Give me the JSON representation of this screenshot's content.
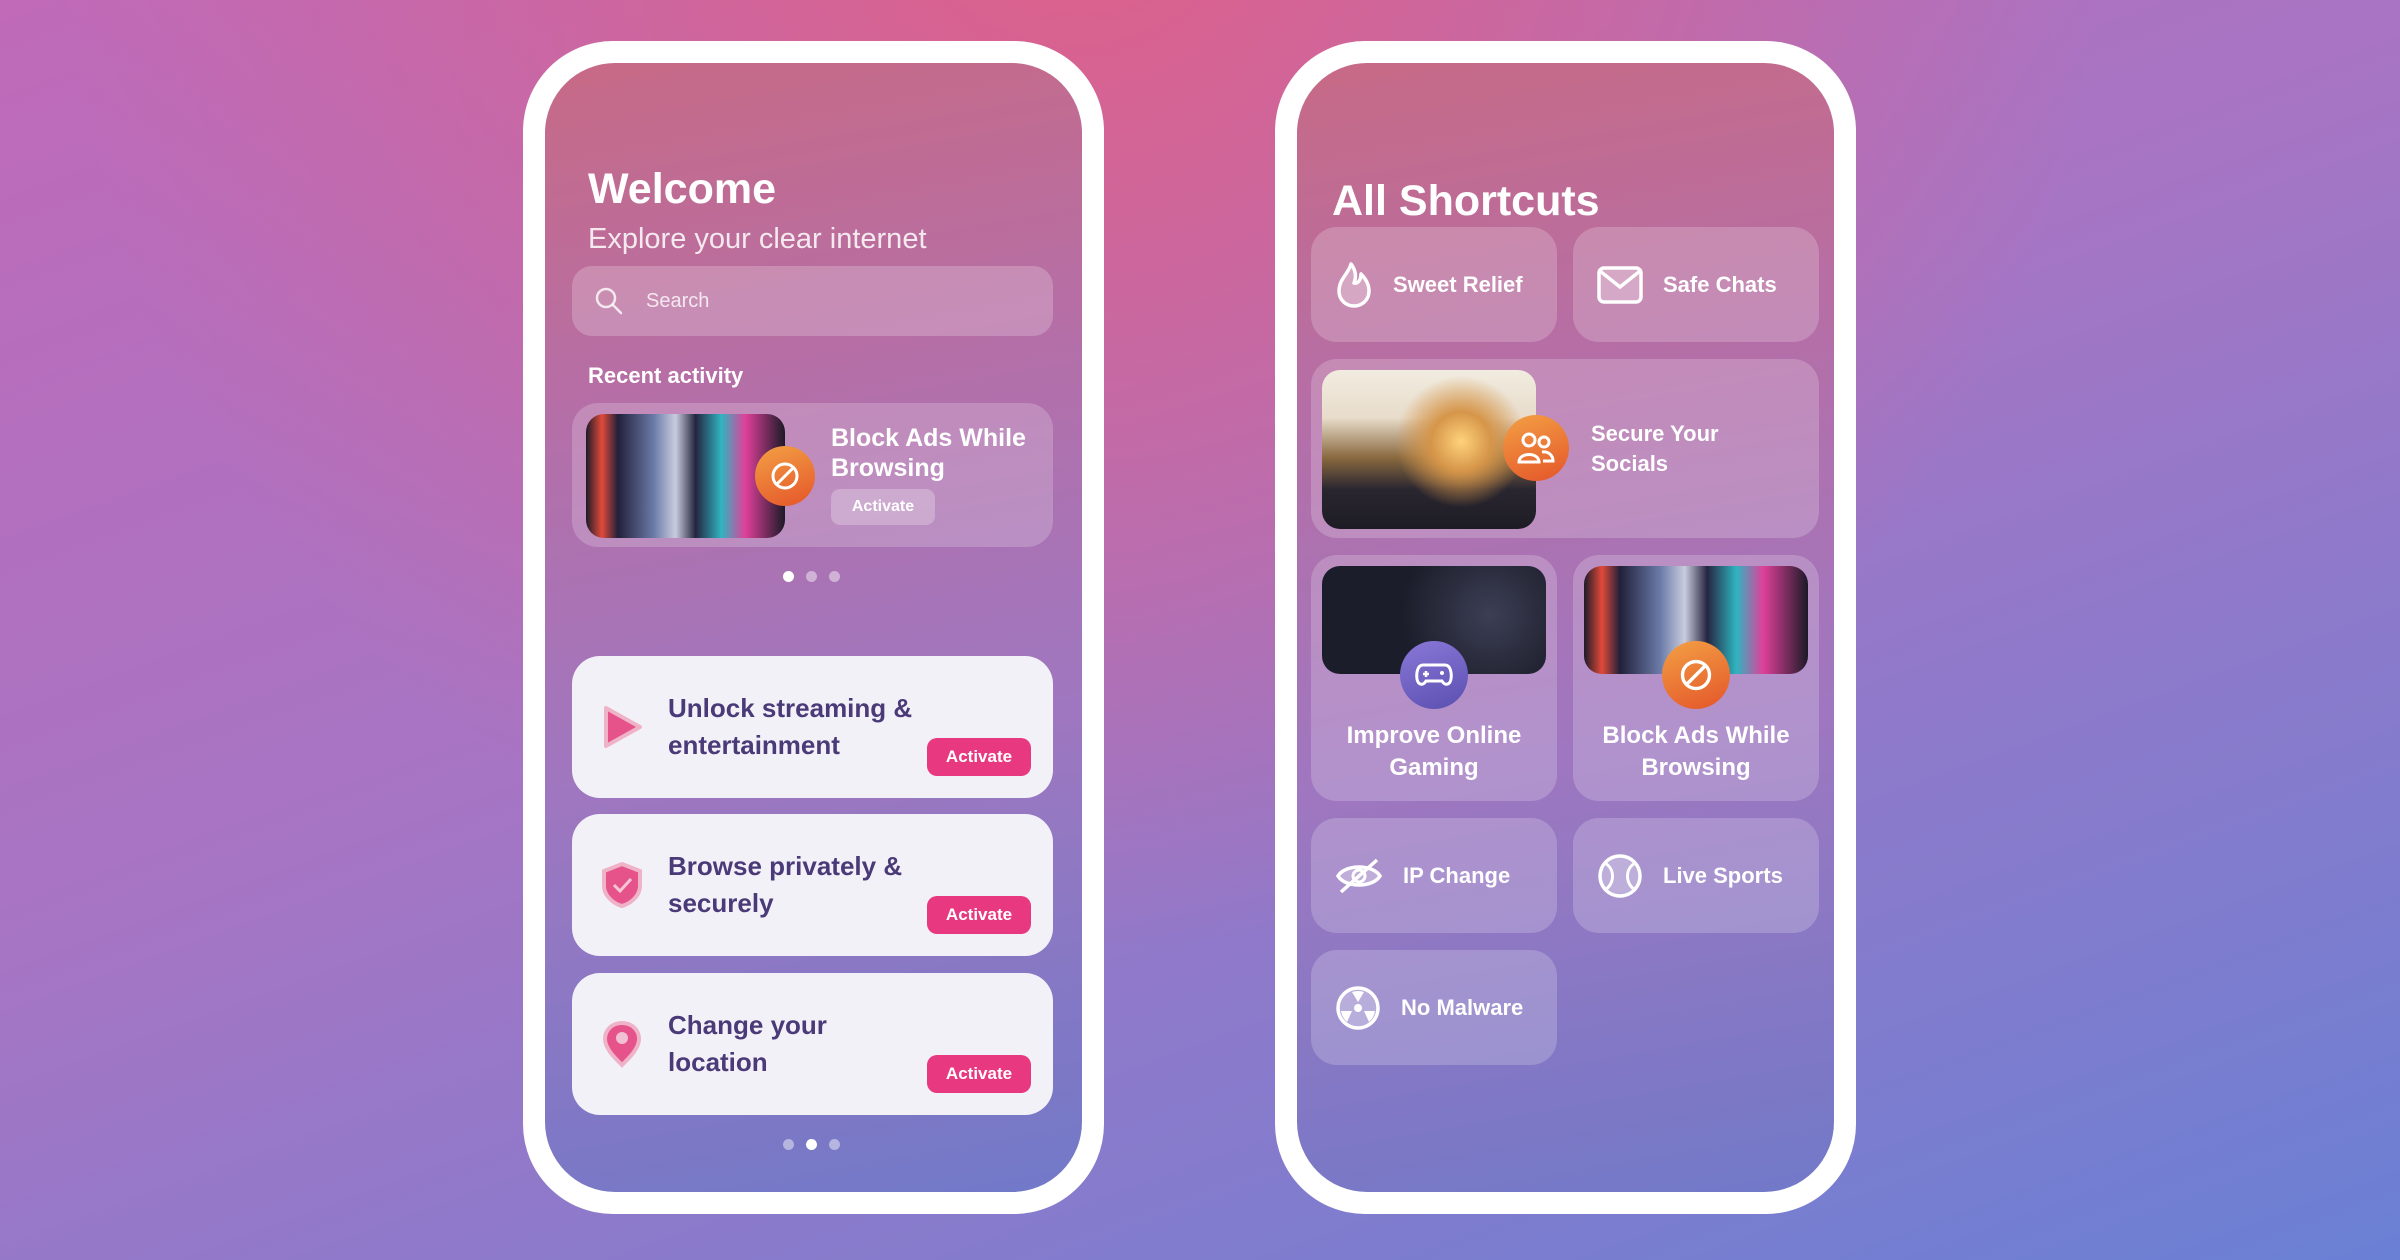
{
  "home": {
    "title": "Welcome",
    "subtitle": "Explore your clear internet",
    "search": {
      "placeholder": "Search",
      "icon": "search-icon"
    },
    "recent_label": "Recent activity",
    "recent": {
      "title": "Block Ads While Browsing",
      "button": "Activate",
      "icon": "block-icon",
      "page": 1,
      "pages": 3
    },
    "features": [
      {
        "label": "Unlock streaming & entertainment",
        "icon": "play-icon",
        "button": "Activate"
      },
      {
        "label": "Browse privately & securely",
        "icon": "shield-check-icon",
        "button": "Activate"
      },
      {
        "label": "Change your location",
        "icon": "location-pin-icon",
        "button": "Activate"
      }
    ],
    "features_page": 2,
    "features_pages": 3
  },
  "shortcuts": {
    "title": "All Shortcuts",
    "items": [
      {
        "label": "Sweet Relief",
        "icon": "flame-icon"
      },
      {
        "label": "Safe Chats",
        "icon": "envelope-icon"
      },
      {
        "label": "Secure Your Socials",
        "icon": "users-icon"
      },
      {
        "label": "Improve Online Gaming",
        "icon": "gamepad-icon"
      },
      {
        "label": "Block Ads While Browsing",
        "icon": "block-icon"
      },
      {
        "label": "IP Change",
        "icon": "eye-off-icon"
      },
      {
        "label": "Live Sports",
        "icon": "ball-icon"
      },
      {
        "label": "No Malware",
        "icon": "radiation-icon"
      }
    ]
  },
  "colors": {
    "accent": "#e8387f",
    "text_dark": "#4a3a78",
    "badge_orange": "#ec7a38"
  }
}
